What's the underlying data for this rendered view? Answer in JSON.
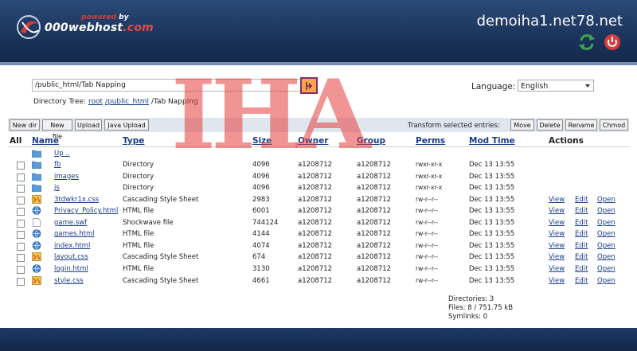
{
  "header": {
    "powered": "powered",
    "by": "by",
    "brand": "000webhost",
    "brand_tld": ".com",
    "site": "demoiha1.net78.net",
    "colors": {
      "header_bg": "#1c355d",
      "accent_red": "#d83a3a",
      "refresh_green": "#3aa84a"
    }
  },
  "nav": {
    "path_value": "/public_html/Tab Napping",
    "language_label": "Language:",
    "language_selected": "English",
    "dirtree_label": "Directory Tree:",
    "tree_root": "root",
    "tree_public": "/public_html",
    "tree_current": "/Tab Napping"
  },
  "toolbar": {
    "new_dir": "New dir",
    "new_file": "New file",
    "upload": "Upload",
    "java_upload": "Java Upload",
    "transform_label": "Transform selected entries:",
    "move": "Move",
    "delete": "Delete",
    "rename": "Rename",
    "chmod": "Chmod"
  },
  "table": {
    "headers": {
      "all": "All",
      "name": "Name",
      "type": "Type",
      "size": "Size",
      "owner": "Owner",
      "group": "Group",
      "perms": "Perms",
      "mtime": "Mod Time",
      "actions": "Actions"
    },
    "up": "Up ..",
    "action_labels": {
      "view": "View",
      "edit": "Edit",
      "open": "Open"
    },
    "rows": [
      {
        "name": "fb",
        "type": "Directory",
        "size": "4096",
        "owner": "a1208712",
        "group": "a1208712",
        "perms": "rwxr-xr-x",
        "mtime": "Dec 13 13:55",
        "icon": "folder-icon",
        "actions": false
      },
      {
        "name": "images",
        "type": "Directory",
        "size": "4096",
        "owner": "a1208712",
        "group": "a1208712",
        "perms": "rwxr-xr-x",
        "mtime": "Dec 13 13:55",
        "icon": "folder-icon",
        "actions": false
      },
      {
        "name": "js",
        "type": "Directory",
        "size": "4096",
        "owner": "a1208712",
        "group": "a1208712",
        "perms": "rwxr-xr-x",
        "mtime": "Dec 13 13:55",
        "icon": "folder-icon",
        "actions": false
      },
      {
        "name": "3tdwkr1x.css",
        "type": "Cascading Style Sheet",
        "size": "2983",
        "owner": "a1208712",
        "group": "a1208712",
        "perms": "rw-r--r--",
        "mtime": "Dec 13 13:55",
        "icon": "css-file-icon",
        "actions": true
      },
      {
        "name": "Privacy_Policy.html",
        "type": "HTML file",
        "size": "6001",
        "owner": "a1208712",
        "group": "a1208712",
        "perms": "rw-r--r--",
        "mtime": "Dec 13 13:55",
        "icon": "html-file-icon",
        "actions": true
      },
      {
        "name": "game.swf",
        "type": "Shockwave file",
        "size": "744124",
        "owner": "a1208712",
        "group": "a1208712",
        "perms": "rw-r--r--",
        "mtime": "Dec 13 13:55",
        "icon": "generic-file-icon",
        "actions": true
      },
      {
        "name": "games.html",
        "type": "HTML file",
        "size": "4144",
        "owner": "a1208712",
        "group": "a1208712",
        "perms": "rw-r--r--",
        "mtime": "Dec 13 13:55",
        "icon": "html-file-icon",
        "actions": true
      },
      {
        "name": "index.html",
        "type": "HTML file",
        "size": "4074",
        "owner": "a1208712",
        "group": "a1208712",
        "perms": "rw-r--r--",
        "mtime": "Dec 13 13:55",
        "icon": "html-file-icon",
        "actions": true
      },
      {
        "name": "layout.css",
        "type": "Cascading Style Sheet",
        "size": "674",
        "owner": "a1208712",
        "group": "a1208712",
        "perms": "rw-r--r--",
        "mtime": "Dec 13 13:55",
        "icon": "css-file-icon",
        "actions": true
      },
      {
        "name": "login.html",
        "type": "HTML file",
        "size": "3130",
        "owner": "a1208712",
        "group": "a1208712",
        "perms": "rw-r--r--",
        "mtime": "Dec 13 13:55",
        "icon": "html-file-icon",
        "actions": true
      },
      {
        "name": "style.css",
        "type": "Cascading Style Sheet",
        "size": "4661",
        "owner": "a1208712",
        "group": "a1208712",
        "perms": "rw-r--r--",
        "mtime": "Dec 13 13:55",
        "icon": "css-file-icon",
        "actions": true
      }
    ]
  },
  "summary": {
    "directories": "Directories: 3",
    "files": "Files: 8 / 751.75 kB",
    "symlinks": "Symlinks: 0"
  },
  "watermark": "IHA"
}
